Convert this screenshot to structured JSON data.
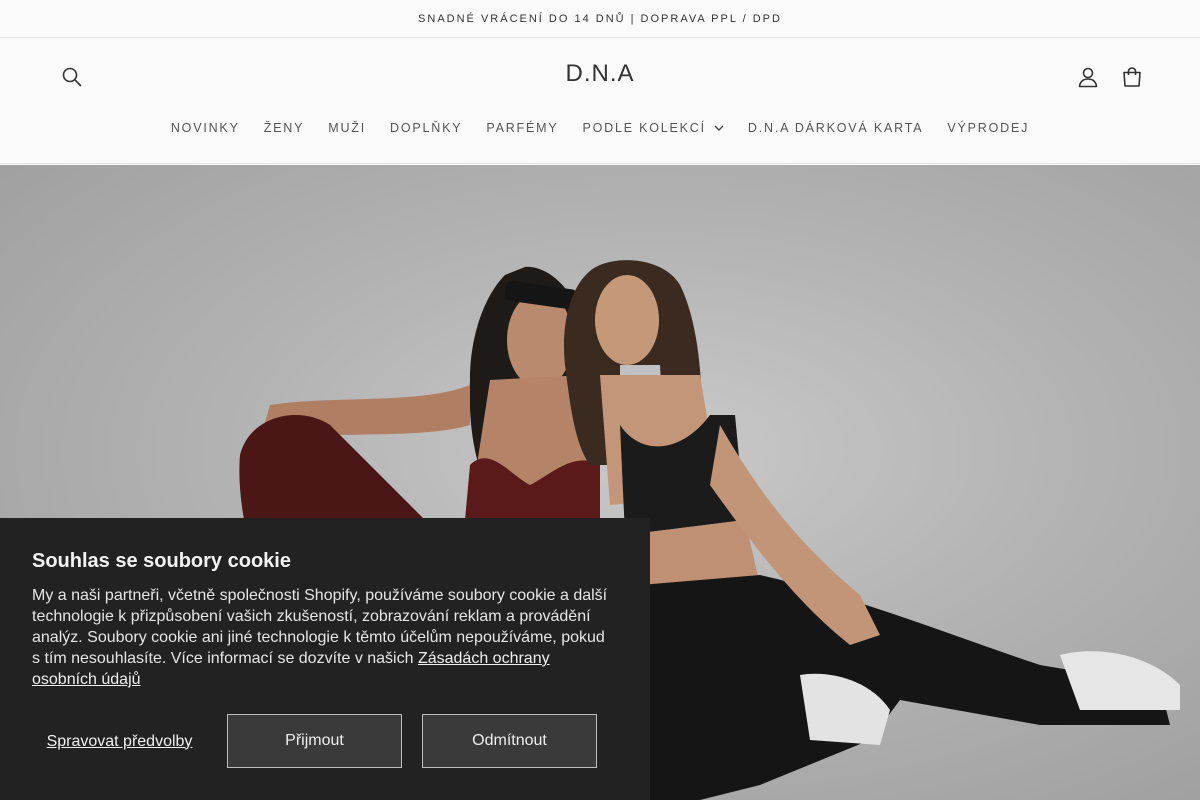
{
  "announcement": "SNADNÉ VRÁCENÍ DO 14 DNŮ | DOPRAVA PPL / DPD",
  "header": {
    "logo": "D.N.A",
    "icons": {
      "search": "search-icon",
      "account": "user-icon",
      "cart": "cart-icon"
    }
  },
  "nav": {
    "items": [
      {
        "label": "NOVINKY"
      },
      {
        "label": "ŽENY"
      },
      {
        "label": "MUŽI"
      },
      {
        "label": "DOPLŇKY"
      },
      {
        "label": "PARFÉMY"
      },
      {
        "label": "PODLE KOLEKCÍ"
      },
      {
        "label": "D.N.A DÁRKOVÁ KARTA"
      },
      {
        "label": "VÝPRODEJ"
      }
    ]
  },
  "cookie": {
    "title": "Souhlas se soubory cookie",
    "text": "My a naši partneři, včetně společnosti Shopify, používáme soubory cookie a další technologie k přizpůsobení vašich zkušeností, zobrazování reklam a provádění analýz. Soubory cookie ani jiné technologie k těmto účelům nepoužíváme, pokud s tím nesouhlasíte. Více informací se dozvíte v našich ",
    "link": "Zásadách ochrany osobních údajů",
    "manage": "Spravovat předvolby",
    "accept": "Přijmout",
    "decline": "Odmítnout"
  },
  "colors": {
    "background": "#fafafa",
    "cookie_bg": "#222222",
    "button_bg": "#3a3a3a"
  }
}
